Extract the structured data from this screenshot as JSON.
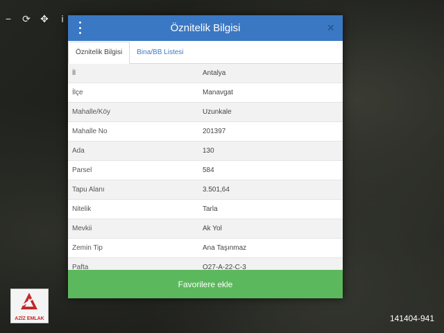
{
  "map": {
    "toolbar_icons": [
      "minus-icon",
      "refresh-icon",
      "move-icon",
      "info-icon"
    ],
    "toolbar_glyphs": [
      "−",
      "⟳",
      "✥",
      "i"
    ]
  },
  "modal": {
    "title": "Öznitelik Bilgisi",
    "close_glyph": "×",
    "tabs": [
      {
        "label": "Öznitelik Bilgisi",
        "active": true
      },
      {
        "label": "Bina/BB Listesi",
        "active": false
      }
    ],
    "rows": [
      {
        "key": "İl",
        "value": "Antalya"
      },
      {
        "key": "İlçe",
        "value": "Manavgat"
      },
      {
        "key": "Mahalle/Köy",
        "value": "Uzunkale"
      },
      {
        "key": "Mahalle No",
        "value": "201397"
      },
      {
        "key": "Ada",
        "value": "130"
      },
      {
        "key": "Parsel",
        "value": "584"
      },
      {
        "key": "Tapu Alanı",
        "value": "3.501,64"
      },
      {
        "key": "Nitelik",
        "value": "Tarla"
      },
      {
        "key": "Mevkii",
        "value": "Ak Yol"
      },
      {
        "key": "Zemin Tip",
        "value": "Ana Taşınmaz"
      },
      {
        "key": "Pafta",
        "value": "O27-A-22-C-3"
      }
    ],
    "favorite_button": "Favorilere ekle"
  },
  "watermark": {
    "logo_text": "AZİZ EMLAK",
    "listing_id": "141404-941"
  },
  "colors": {
    "header": "#3b78c3",
    "button": "#5cb85c"
  }
}
